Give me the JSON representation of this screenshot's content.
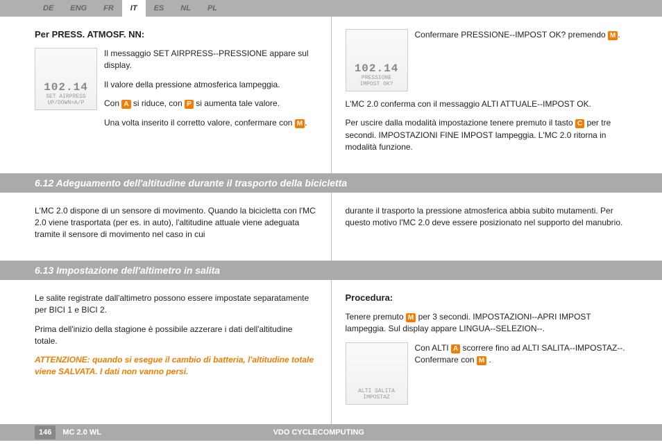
{
  "langs": [
    "DE",
    "ENG",
    "FR",
    "IT",
    "ES",
    "NL",
    "PL"
  ],
  "active_lang": "IT",
  "s1": {
    "head": "Per PRESS. ATMOSF. NN:",
    "lcd_big": "102.14",
    "lcd_sm1": "SET AIRPRESS",
    "lcd_sm2": "UP/DOWN=A/P",
    "p1a": "Il messaggio SET AIRPRESS--PRESSIONE appare sul display.",
    "p1b": "Il valore della pressione atmosferica lampeggia.",
    "p1c_1": "Con ",
    "p1c_2": " si riduce, con ",
    "p1c_3": " si aumenta tale valore.",
    "p1d_1": "Una volta inserito il corretto valore, confermare con ",
    "p1d_2": "."
  },
  "s1r": {
    "lcd_big": "102.14",
    "lcd_sm1": "PRESSIONE",
    "lcd_sm2": "IMPOST OK?",
    "p1_1": "Confermare PRESSIONE--IMPOST OK? premendo ",
    "p1_2": ".",
    "p2": "L'MC 2.0 conferma con il messaggio ALTI ATTUALE--IMPOST OK.",
    "p3_1": "Per uscire dalla modalità impostazione tenere premuto il tasto ",
    "p3_2": " per tre secondi. IMPOSTAZIONI FINE IMPOST lampeggia. L'MC 2.0 ritorna in modalità funzione."
  },
  "sec612": {
    "title": "6.12 Adeguamento dell'altitudine durante il trasporto della bicicletta",
    "left": "L'MC 2.0 dispone di un sensore di movimento. Quando la bicicletta con l'MC 2.0 viene trasportata (per es. in auto), l'altitudine attuale viene adeguata tramite il sensore di movimento nel caso in cui",
    "right": "durante il trasporto la pressione atmosferica abbia subito mutamenti. Per questo motivo l'MC 2.0 deve essere posizionato nel supporto del manubrio."
  },
  "sec613": {
    "title": "6.13 Impostazione dell'altimetro in salita",
    "l1": "Le salite registrate dall'altimetro possono essere impostate separatamente per BICI 1 e BICI 2.",
    "l2": "Prima dell'inizio della stagione è possibile azzerare i dati dell'altitudine totale.",
    "warn": "ATTENZIONE: quando si esegue il cambio di batteria, l'altitudine totale viene SALVATA. I dati non vanno persi.",
    "proc_head": "Procedura:",
    "r1_1": "Tenere premuto ",
    "r1_2": " per 3 secondi. IMPOSTAZIONI--APRI IMPOST lampeggia. Sul display appare LINGUA--SELEZION--.",
    "lcd_sm1": "ALTI SALITA",
    "lcd_sm2": "IMPOSTAZ",
    "r2_1": "Con ALTI ",
    "r2_2": " scorrere fino ad ALTI SALITA--IMPOSTAZ--. Confermare con ",
    "r2_3": " ."
  },
  "keys": {
    "A": "A",
    "P": "P",
    "M": "M",
    "C": "C"
  },
  "footer": {
    "page": "146",
    "model": "MC 2.0 WL",
    "brand": "VDO CYCLECOMPUTING"
  }
}
